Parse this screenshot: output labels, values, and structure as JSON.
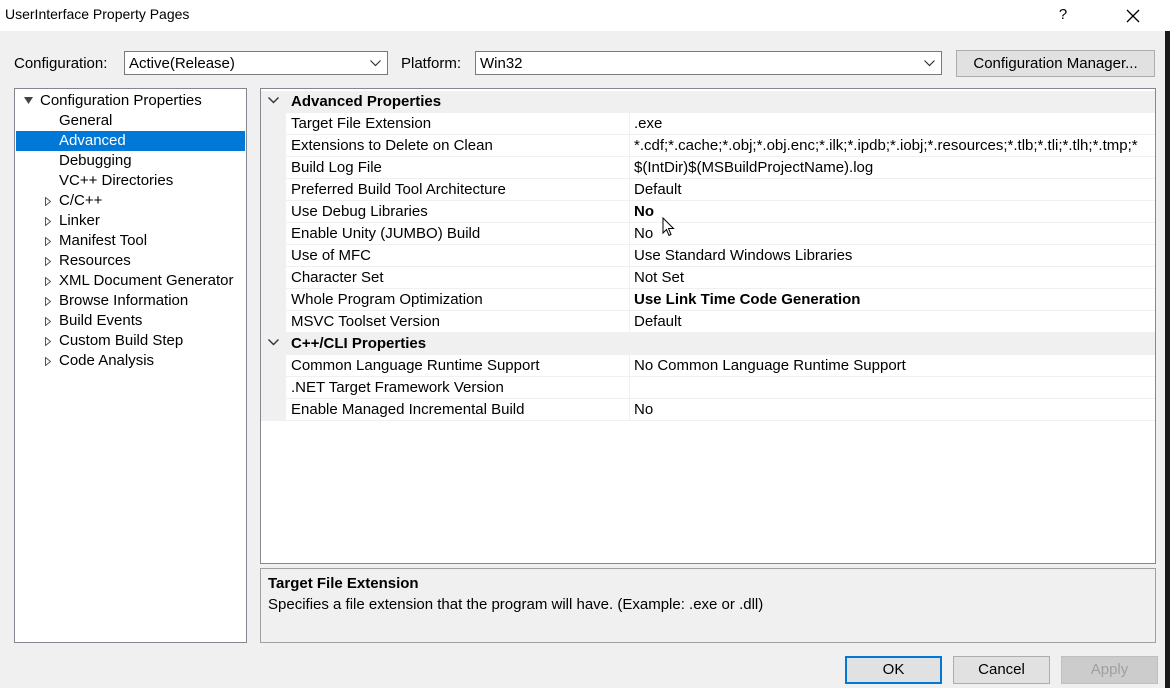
{
  "window": {
    "title": "UserInterface Property Pages",
    "help_label": "?"
  },
  "config_bar": {
    "configuration_label": "Configuration:",
    "configuration_value": "Active(Release)",
    "platform_label": "Platform:",
    "platform_value": "Win32",
    "config_manager_label": "Configuration Manager..."
  },
  "tree": {
    "root": "Configuration Properties",
    "items": [
      {
        "label": "General",
        "expandable": false
      },
      {
        "label": "Advanced",
        "expandable": false,
        "selected": true
      },
      {
        "label": "Debugging",
        "expandable": false
      },
      {
        "label": "VC++ Directories",
        "expandable": false
      },
      {
        "label": "C/C++",
        "expandable": true
      },
      {
        "label": "Linker",
        "expandable": true
      },
      {
        "label": "Manifest Tool",
        "expandable": true
      },
      {
        "label": "Resources",
        "expandable": true
      },
      {
        "label": "XML Document Generator",
        "expandable": true
      },
      {
        "label": "Browse Information",
        "expandable": true
      },
      {
        "label": "Build Events",
        "expandable": true
      },
      {
        "label": "Custom Build Step",
        "expandable": true
      },
      {
        "label": "Code Analysis",
        "expandable": true
      }
    ]
  },
  "grid": {
    "categories": [
      {
        "name": "Advanced Properties",
        "rows": [
          {
            "name": "Target File Extension",
            "value": ".exe",
            "bold": false
          },
          {
            "name": "Extensions to Delete on Clean",
            "value": "*.cdf;*.cache;*.obj;*.obj.enc;*.ilk;*.ipdb;*.iobj;*.resources;*.tlb;*.tli;*.tlh;*.tmp;*",
            "bold": false
          },
          {
            "name": "Build Log File",
            "value": "$(IntDir)$(MSBuildProjectName).log",
            "bold": false
          },
          {
            "name": "Preferred Build Tool Architecture",
            "value": "Default",
            "bold": false
          },
          {
            "name": "Use Debug Libraries",
            "value": "No",
            "bold": true
          },
          {
            "name": "Enable Unity (JUMBO) Build",
            "value": "No",
            "bold": false
          },
          {
            "name": "Use of MFC",
            "value": "Use Standard Windows Libraries",
            "bold": false
          },
          {
            "name": "Character Set",
            "value": "Not Set",
            "bold": false
          },
          {
            "name": "Whole Program Optimization",
            "value": "Use Link Time Code Generation",
            "bold": true
          },
          {
            "name": "MSVC Toolset Version",
            "value": "Default",
            "bold": false
          }
        ]
      },
      {
        "name": "C++/CLI Properties",
        "rows": [
          {
            "name": "Common Language Runtime Support",
            "value": "No Common Language Runtime Support",
            "bold": false
          },
          {
            "name": ".NET Target Framework Version",
            "value": "",
            "bold": false
          },
          {
            "name": "Enable Managed Incremental Build",
            "value": "No",
            "bold": false
          }
        ]
      }
    ]
  },
  "description": {
    "title": "Target File Extension",
    "text": "Specifies a file extension that the program will have. (Example: .exe or .dll)"
  },
  "buttons": {
    "ok": "OK",
    "cancel": "Cancel",
    "apply": "Apply"
  }
}
